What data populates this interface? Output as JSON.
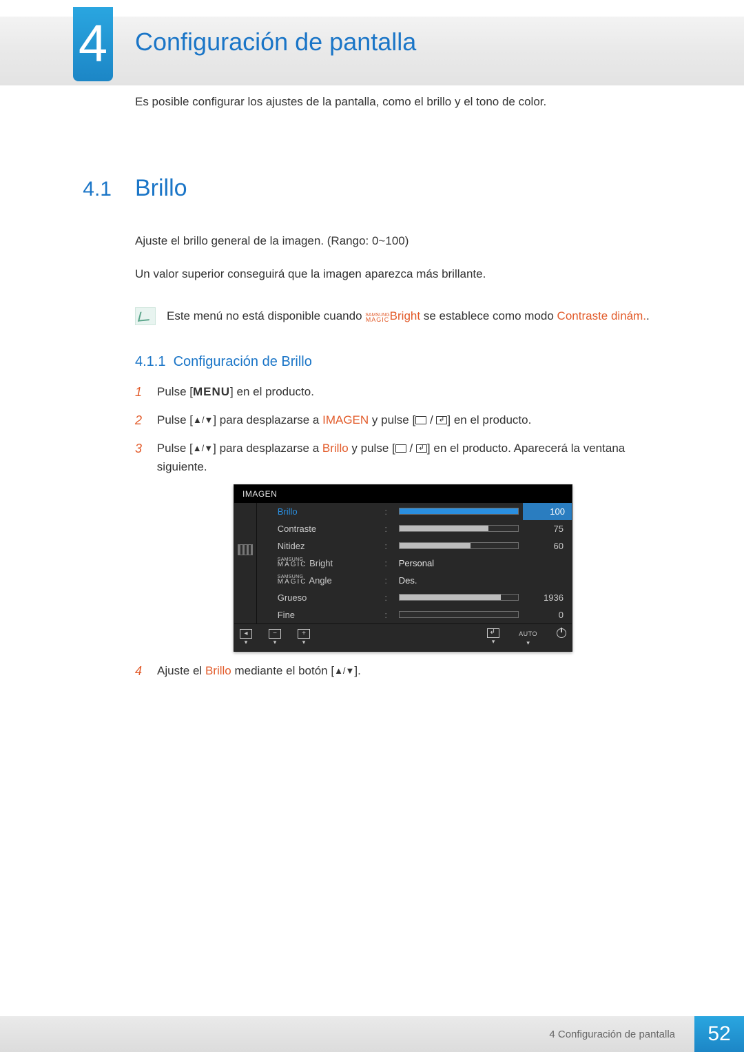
{
  "chapter": {
    "number": "4",
    "title": "Configuración de pantalla",
    "intro": "Es posible configurar los ajustes de la pantalla, como el brillo y el tono de color."
  },
  "section": {
    "number": "4.1",
    "title": "Brillo",
    "para1": "Ajuste el brillo general de la imagen. (Rango: 0~100)",
    "para2": "Un valor superior conseguirá que la imagen aparezca más brillante."
  },
  "note": {
    "prefix": "Este menú no está disponible cuando ",
    "magic_top": "SAMSUNG",
    "magic_bot": "MAGIC",
    "bright": "Bright",
    "mid": " se establece como modo ",
    "mode": "Contraste dinám.",
    "suffix": "."
  },
  "subsection": {
    "number": "4.1.1",
    "title": "Configuración de Brillo"
  },
  "steps": {
    "s1": {
      "n": "1",
      "t1": "Pulse [",
      "menu": "MENU",
      "t2": "] en el producto."
    },
    "s2": {
      "n": "2",
      "t1": "Pulse [",
      "t2": "] para desplazarse a ",
      "imagen": "IMAGEN",
      "t3": " y pulse [",
      "t4": "] en el producto."
    },
    "s3": {
      "n": "3",
      "t1": "Pulse [",
      "t2": "] para desplazarse a ",
      "brillo": "Brillo",
      "t3": " y pulse [",
      "t4": "] en el producto. Aparecerá la ventana siguiente."
    },
    "s4": {
      "n": "4",
      "t1": "Ajuste el ",
      "brillo": "Brillo",
      "t2": " mediante el botón [",
      "t3": "]."
    }
  },
  "osd": {
    "header": "IMAGEN",
    "rows": {
      "brillo": {
        "label": "Brillo",
        "val": 100,
        "max": 100,
        "selected": true
      },
      "contraste": {
        "label": "Contraste",
        "val": 75,
        "max": 100
      },
      "nitidez": {
        "label": "Nitidez",
        "val": 60,
        "max": 100
      },
      "magic_bright": {
        "label_suffix": "Bright",
        "text": "Personal"
      },
      "magic_angle": {
        "label_suffix": "Angle",
        "text": "Des."
      },
      "grueso": {
        "label": "Grueso",
        "val": 1936,
        "fill_pct": 86
      },
      "fine": {
        "label": "Fine",
        "val": 0,
        "fill_pct": 0
      }
    },
    "magic": {
      "top": "SAMSUNG",
      "bot": "MAGIC"
    },
    "footer": {
      "auto": "AUTO"
    }
  },
  "footer": {
    "text": "4 Configuración de pantalla",
    "page": "52"
  }
}
